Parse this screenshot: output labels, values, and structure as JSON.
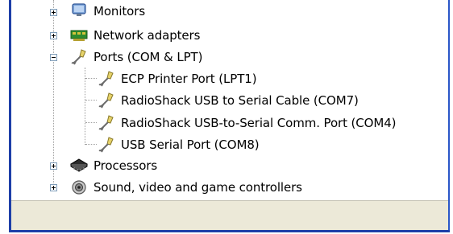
{
  "tree": {
    "categories": [
      {
        "label": "Monitors",
        "icon": "monitor-icon",
        "expanded": false
      },
      {
        "label": "Network adapters",
        "icon": "network-adapter-icon",
        "expanded": false
      },
      {
        "label": "Ports (COM & LPT)",
        "icon": "port-connector-icon",
        "expanded": true,
        "children": [
          {
            "label": "ECP Printer Port (LPT1)",
            "icon": "port-connector-icon"
          },
          {
            "label": "RadioShack USB to Serial Cable (COM7)",
            "icon": "port-connector-icon"
          },
          {
            "label": "RadioShack USB-to-Serial Comm. Port (COM4)",
            "icon": "port-connector-icon"
          },
          {
            "label": "USB Serial Port (COM8)",
            "icon": "port-connector-icon"
          }
        ]
      },
      {
        "label": "Processors",
        "icon": "processor-icon",
        "expanded": false
      },
      {
        "label": "Sound, video and game controllers",
        "icon": "speaker-icon",
        "expanded": false
      }
    ]
  },
  "colors": {
    "window_border": "#1e3fa8",
    "status_bar": "#ece9d8",
    "tree_lines": "#a0a0a0",
    "expander_border": "#7f9db9"
  }
}
